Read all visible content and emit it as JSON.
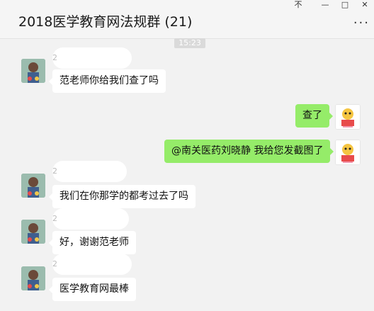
{
  "title": "2018医学教育网法规群 (21)",
  "window_controls": {
    "pin": "不",
    "minimize": "—",
    "maximize": "□",
    "close": "✕"
  },
  "more_label": "···",
  "timestamp": "15:23",
  "sender_prefix": "2",
  "messages": [
    {
      "side": "left",
      "text": "范老师你给我们查了吗"
    },
    {
      "side": "right",
      "text": "查了"
    },
    {
      "side": "right",
      "text": "@南关医药刘晓静 我给您发截图了"
    },
    {
      "side": "left",
      "text": "我们在你那学的都考过去了吗"
    },
    {
      "side": "left",
      "text": "好，谢谢范老师"
    },
    {
      "side": "left",
      "text": "医学教育网最棒"
    }
  ],
  "colors": {
    "outgoing_bubble": "#95ec69",
    "incoming_bubble": "#ffffff",
    "background": "#f2f2f2"
  },
  "icons": {
    "left_avatar": "child-photo-avatar",
    "right_avatar": "cartoon-mascot-avatar"
  }
}
